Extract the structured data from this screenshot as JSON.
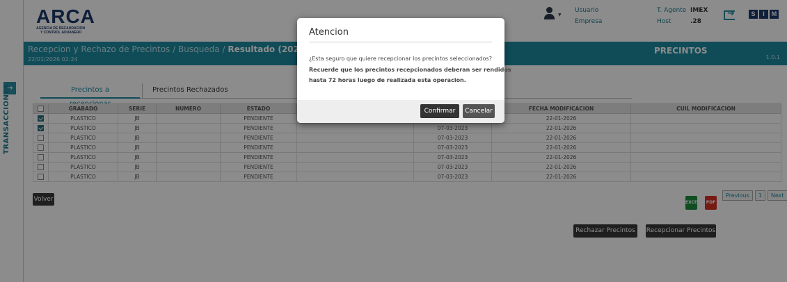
{
  "header": {
    "logo_main": "ARCA",
    "logo_sub1": "AGENCIA DE RECAUDACION",
    "logo_sub2": "Y CONTROL ADUANERO",
    "usuario_label": "Usuario",
    "empresa_label": "Empresa",
    "tipo_agente_label": "T. Agente",
    "tipo_agente_value": "IMEX",
    "host_label": "Host",
    "host_value": ".28",
    "sim_logo": [
      "S",
      "I",
      "M"
    ]
  },
  "topbar": {
    "breadcrumb": "Recepcion y Rechazo de Precintos / Busqueda / ",
    "breadcrumb_current": "Resultado (20214128013)",
    "datetime": "22/01/2026 02:24",
    "module": "PRECINTOS",
    "version": "1.0.1"
  },
  "sidebar": {
    "label": "TRANSACCIONES",
    "expand": "→"
  },
  "tabs": [
    {
      "label": "Precintos a recepcionar",
      "active": true
    },
    {
      "label": "Precintos Rechazados",
      "active": false
    }
  ],
  "table": {
    "columns": [
      "GRABADO",
      "SERIE",
      "NUMERO",
      "ESTADO",
      "",
      "",
      "FECHA MODIFICACION",
      "CUIL MODIFICACION"
    ],
    "rows": [
      {
        "checked": true,
        "cells": [
          "PLASTICO",
          "JB",
          "",
          "PENDIENTE",
          "",
          "",
          "22-01-2026",
          ""
        ]
      },
      {
        "checked": true,
        "cells": [
          "PLASTICO",
          "JB",
          "",
          "PENDIENTE",
          "",
          "07-03-2023",
          "22-01-2026",
          ""
        ]
      },
      {
        "checked": false,
        "cells": [
          "PLASTICO",
          "JB",
          "",
          "PENDIENTE",
          "",
          "07-03-2023",
          "22-01-2026",
          ""
        ]
      },
      {
        "checked": false,
        "cells": [
          "PLASTICO",
          "JB",
          "",
          "PENDIENTE",
          "",
          "07-03-2023",
          "22-01-2026",
          ""
        ]
      },
      {
        "checked": false,
        "cells": [
          "PLASTICO",
          "JB",
          "",
          "PENDIENTE",
          "",
          "07-03-2023",
          "22-01-2026",
          ""
        ]
      },
      {
        "checked": false,
        "cells": [
          "PLASTICO",
          "JB",
          "",
          "PENDIENTE",
          "",
          "07-03-2023",
          "22-01-2026",
          ""
        ]
      },
      {
        "checked": false,
        "cells": [
          "PLASTICO",
          "JB",
          "",
          "PENDIENTE",
          "",
          "07-03-2023",
          "22-01-2026",
          ""
        ]
      }
    ]
  },
  "buttons": {
    "volver": "Volver",
    "rechazar": "Rechazar Precintos",
    "recepcionar": "Recepcionar Precintos",
    "excel": "EXCEL",
    "pdf": "PDF"
  },
  "pager": {
    "previous": "Previous",
    "page": "1",
    "next": "Next"
  },
  "modal": {
    "title": "Atencion",
    "line1": "¿Esta seguro que quiere recepcionar los precintos seleccionados?",
    "line2": "Recuerde que los precintos recepcionados deberan ser rendidos",
    "line3": "hasta 72 horas luego de realizada esta operacion.",
    "confirm": "Confirmar",
    "cancel": "Cancelar"
  },
  "colors": {
    "accent": "#1d8aa0",
    "brand": "#1b3a6b"
  }
}
